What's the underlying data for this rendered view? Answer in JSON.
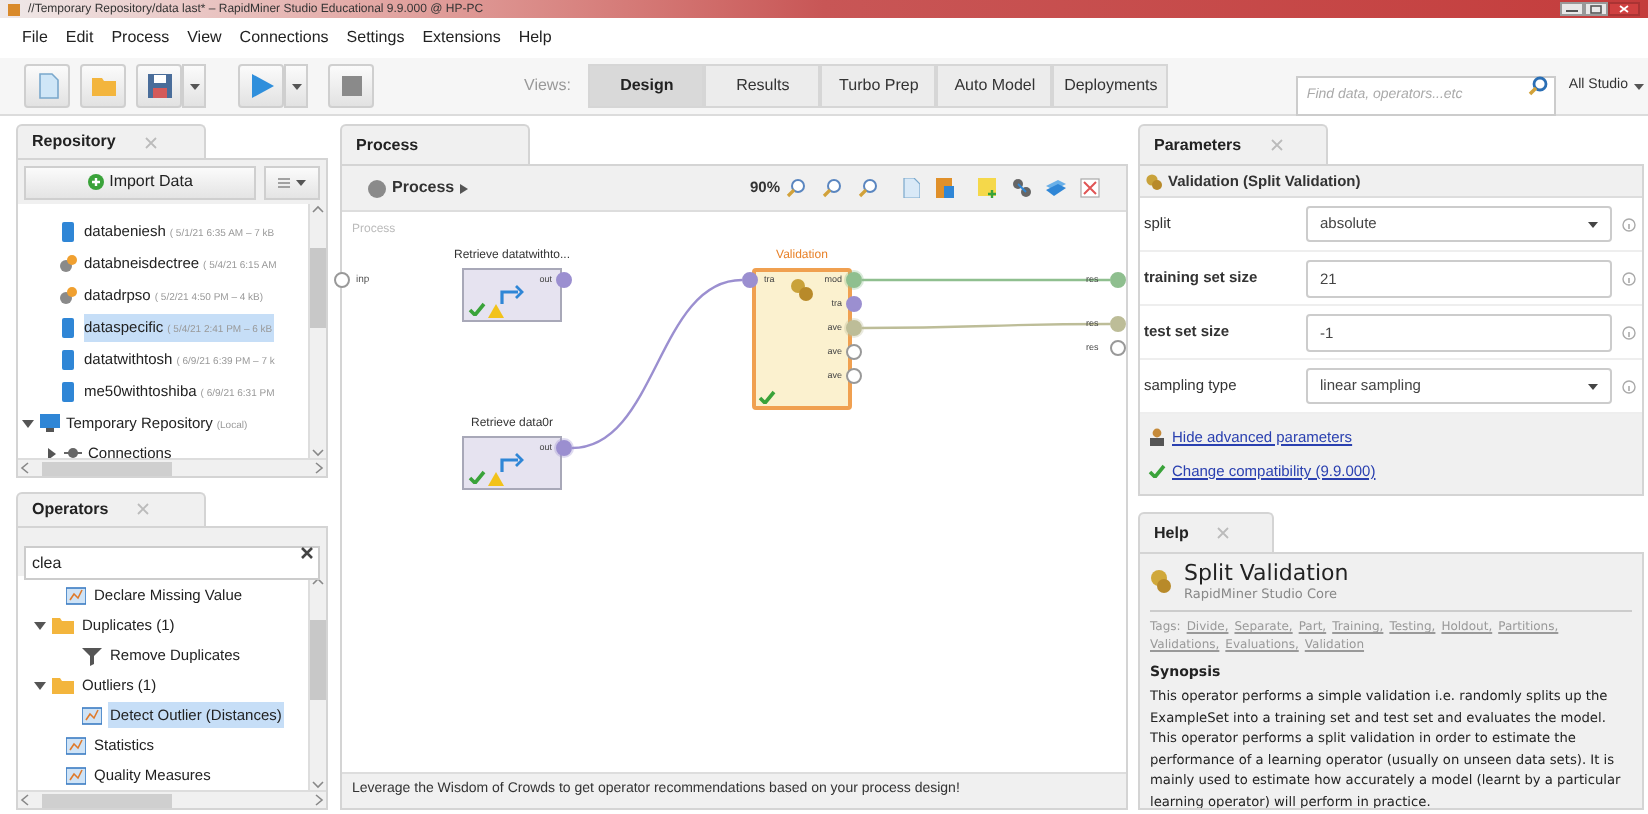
{
  "window": {
    "title": "//Temporary Repository/data last* – RapidMiner Studio Educational 9.9.000 @ HP-PC"
  },
  "menu": [
    "File",
    "Edit",
    "Process",
    "View",
    "Connections",
    "Settings",
    "Extensions",
    "Help"
  ],
  "toolbar": {
    "views_label": "Views:",
    "views": [
      {
        "label": "Design",
        "selected": true
      },
      {
        "label": "Results",
        "selected": false
      },
      {
        "label": "Turbo Prep",
        "selected": false
      },
      {
        "label": "Auto Model",
        "selected": false
      },
      {
        "label": "Deployments",
        "selected": false
      }
    ],
    "search": {
      "placeholder": "Find data, operators...etc"
    },
    "scope": "All Studio"
  },
  "repository": {
    "tab": "Repository",
    "import_button": "Import Data",
    "entries": [
      {
        "name": "databeniesh",
        "meta": "( 5/1/21 6:35 AM – 7 kB",
        "kind": "data",
        "selected": false
      },
      {
        "name": "databneisdectree",
        "meta": "( 5/4/21 6:15 AM",
        "kind": "model",
        "selected": false
      },
      {
        "name": "datadrpso",
        "meta": "( 5/2/21 4:50 PM – 4 kB)",
        "kind": "model",
        "selected": false
      },
      {
        "name": "dataspecific",
        "meta": "( 5/4/21 2:41 PM – 6 kB",
        "kind": "data",
        "selected": true
      },
      {
        "name": "datatwithtosh",
        "meta": "( 6/9/21 6:39 PM – 7 k",
        "kind": "data",
        "selected": false
      },
      {
        "name": "me50withtoshiba",
        "meta": "( 6/9/21 6:31 PM",
        "kind": "data",
        "selected": false
      }
    ],
    "tree": [
      {
        "label": "Temporary Repository",
        "meta": "(Local)",
        "expanded": true,
        "children": [
          {
            "label": "Connections",
            "expanded": false
          }
        ]
      }
    ]
  },
  "operators": {
    "tab": "Operators",
    "search": "clea",
    "tree": [
      {
        "label": "Declare Missing Value",
        "kind": "operator",
        "selected": false
      },
      {
        "label": "Duplicates (1)",
        "kind": "folder",
        "expanded": true,
        "children": [
          {
            "label": "Remove Duplicates",
            "kind": "filter",
            "selected": false
          }
        ]
      },
      {
        "label": "Outliers (1)",
        "kind": "folder",
        "expanded": true,
        "children": [
          {
            "label": "Detect Outlier (Distances)",
            "kind": "operator",
            "selected": true
          }
        ]
      },
      {
        "label": "Statistics",
        "kind": "operator",
        "selected": false
      },
      {
        "label": "Quality Measures",
        "kind": "operator",
        "selected": false
      }
    ]
  },
  "process": {
    "tab": "Process",
    "breadcrumb": "Process",
    "zoom": "90%",
    "canvas_label": "Process",
    "input_port": "inp",
    "operators": [
      {
        "name": "Retrieve datatwithto...",
        "kind": "retrieve",
        "selected": false,
        "warning": true,
        "ports_out": [
          {
            "label": "out",
            "filled": true,
            "color": "#9b8fd0",
            "connected": false
          }
        ]
      },
      {
        "name": "Retrieve data0r",
        "kind": "retrieve",
        "selected": false,
        "warning": true,
        "ports_out": [
          {
            "label": "out",
            "filled": true,
            "color": "#9b8fd0",
            "connected": true
          }
        ]
      },
      {
        "name": "Validation",
        "kind": "validation",
        "selected": true,
        "ports_in": [
          {
            "label": "tra",
            "filled": true,
            "color": "#9b8fd0"
          }
        ],
        "ports_out": [
          {
            "label": "mod",
            "filled": true,
            "color": "#8fbf8f",
            "connected": true
          },
          {
            "label": "tra",
            "filled": true,
            "color": "#9b8fd0",
            "connected": false
          },
          {
            "label": "ave",
            "filled": true,
            "color": "#bdbd98",
            "connected": true
          },
          {
            "label": "ave",
            "filled": false
          },
          {
            "label": "ave",
            "filled": false
          }
        ]
      }
    ],
    "result_ports": [
      {
        "label": "res",
        "filled": true,
        "color": "#8fbf8f"
      },
      {
        "label": "res",
        "filled": true,
        "color": "#bdbd98"
      },
      {
        "label": "res",
        "filled": false
      }
    ],
    "message": "Leverage the Wisdom of Crowds to get operator recommendations based on your process design!"
  },
  "parameters": {
    "tab": "Parameters",
    "operator": "Validation (Split Validation)",
    "rows": [
      {
        "label": "split",
        "kind": "select",
        "value": "absolute",
        "emphasized": false
      },
      {
        "label": "training set size",
        "kind": "text",
        "value": "21",
        "emphasized": true
      },
      {
        "label": "test set size",
        "kind": "text",
        "value": "-1",
        "emphasized": true
      },
      {
        "label": "sampling type",
        "kind": "select",
        "value": "linear sampling",
        "emphasized": false
      }
    ],
    "links": [
      {
        "label": "Hide advanced parameters",
        "kind": "advanced"
      },
      {
        "label": "Change compatibility (9.9.000)",
        "kind": "compatibility"
      }
    ]
  },
  "help": {
    "tab": "Help",
    "title": "Split Validation",
    "subtitle": "RapidMiner Studio Core",
    "tags_label": "Tags:",
    "tags": [
      "Divide,",
      "Separate,",
      "Part,",
      "Training,",
      "Testing,",
      "Holdout,",
      "Partitions,",
      "Validations,",
      "Evaluations,",
      "Validation"
    ],
    "section": "Synopsis",
    "text": "This operator performs a simple validation i.e. randomly splits up the ExampleSet into a training set and test set and evaluates the model. This operator performs a split validation in order to estimate the performance of a learning operator (usually on unseen data sets). It is mainly used to estimate how accurately a model (learnt by a particular learning operator) will perform in practice."
  }
}
